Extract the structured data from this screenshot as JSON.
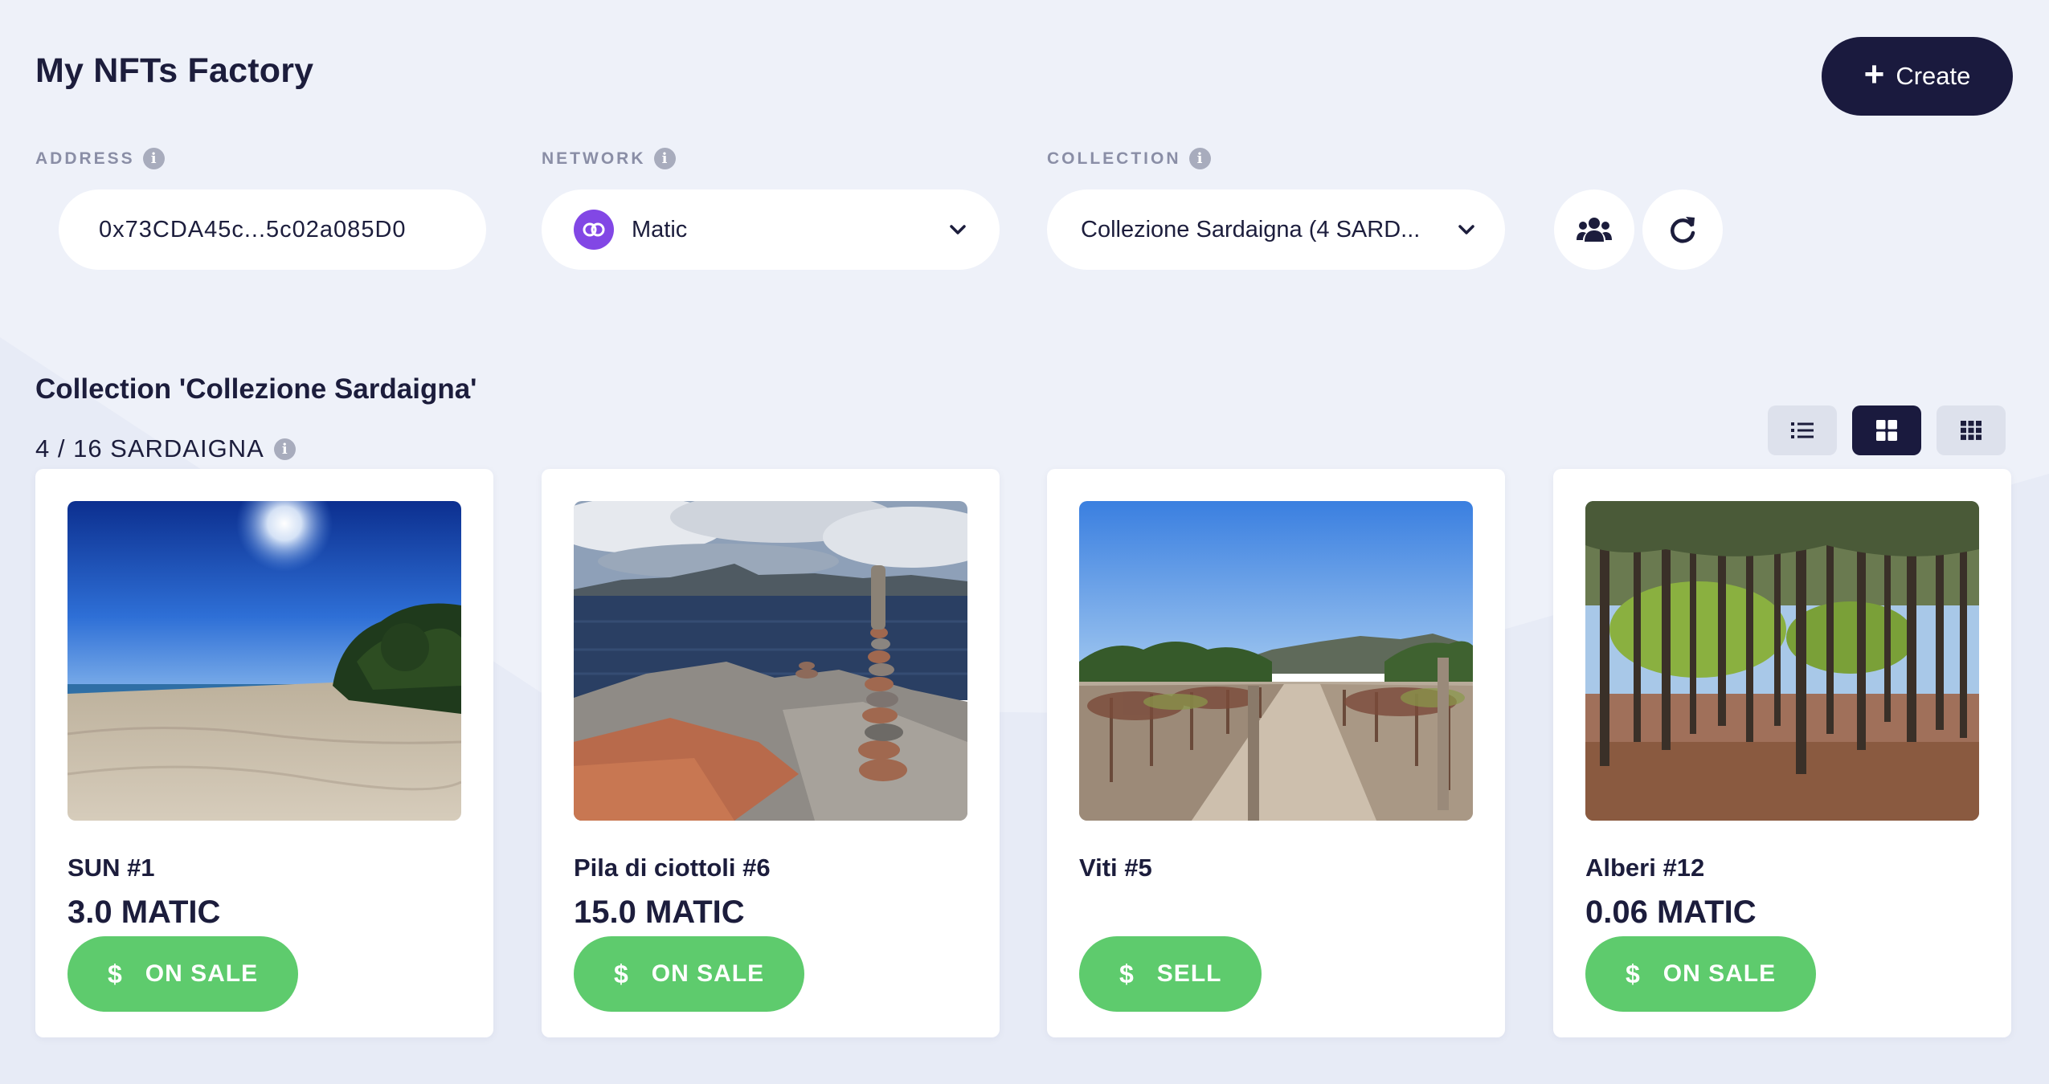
{
  "header": {
    "title": "My NFTs Factory",
    "create_label": "Create"
  },
  "filters": {
    "address_label": "ADDRESS",
    "address_value": "0x73CDA45c...5c02a085D0",
    "network_label": "NETWORK",
    "network_value": "Matic",
    "collection_label": "COLLECTION",
    "collection_value": "Collezione Sardaigna (4 SARD..."
  },
  "collection": {
    "title": "Collection 'Collezione Sardaigna'",
    "count": "4 / 16 SARDAIGNA"
  },
  "cards": [
    {
      "name": "SUN #1",
      "price": "3.0 MATIC",
      "action": "ON SALE",
      "image": "beach-photo"
    },
    {
      "name": "Pila di ciottoli #6",
      "price": "15.0 MATIC",
      "action": "ON SALE",
      "image": "rock-cairn-photo"
    },
    {
      "name": "Viti #5",
      "price": "",
      "action": "SELL",
      "image": "vineyard-photo"
    },
    {
      "name": "Alberi #12",
      "price": "0.06 MATIC",
      "action": "ON SALE",
      "image": "pine-forest-photo"
    }
  ],
  "colors": {
    "primary": "#1a1a3e",
    "success": "#5ecb6d",
    "background": "#eef1f9",
    "polygon": "#8247e5"
  }
}
